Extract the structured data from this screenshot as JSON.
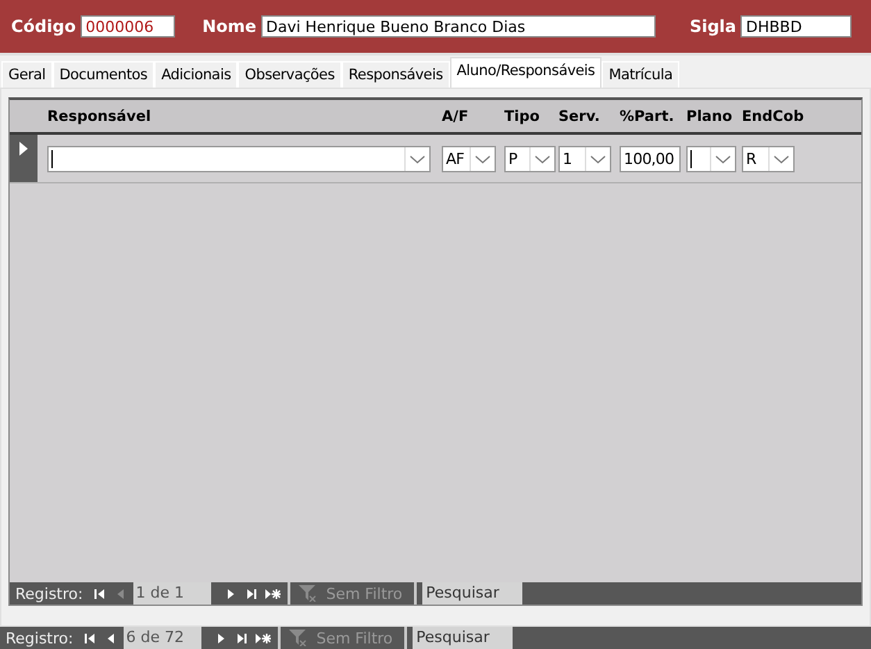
{
  "header": {
    "fields": [
      {
        "label": "Código",
        "value": "0000006",
        "kind": "code"
      },
      {
        "label": "Nome",
        "value": "Davi Henrique Bueno Branco Dias",
        "kind": "text"
      },
      {
        "label": "Sigla",
        "value": "DHBBD",
        "kind": "text"
      }
    ]
  },
  "tabs": [
    {
      "label": "Geral",
      "selected": false
    },
    {
      "label": "Documentos",
      "selected": false
    },
    {
      "label": "Adicionais",
      "selected": false
    },
    {
      "label": "Observações",
      "selected": false
    },
    {
      "label": "Responsáveis",
      "selected": false
    },
    {
      "label": "Aluno/Responsáveis",
      "selected": true
    },
    {
      "label": "Matrícula",
      "selected": false
    }
  ],
  "subform": {
    "columns": [
      {
        "header": "Responsável",
        "kind": "combo"
      },
      {
        "header": "A/F",
        "value": "AF",
        "kind": "combo"
      },
      {
        "header": "Tipo",
        "value": "P",
        "kind": "combo"
      },
      {
        "header": "Serv.",
        "value": "1",
        "kind": "combo"
      },
      {
        "header": "%Part.",
        "value": "100,00",
        "kind": "text"
      },
      {
        "header": "Plano",
        "kind": "combo"
      },
      {
        "header": "EndCob",
        "value": "R",
        "kind": "combo"
      }
    ],
    "nav": {
      "label": "Registro:",
      "position": "1 de 1",
      "prev_disabled": true,
      "filter": "Sem Filtro",
      "search": "Pesquisar"
    }
  },
  "nav": {
    "label": "Registro:",
    "position": "6 de 72",
    "prev_disabled": false,
    "filter": "Sem Filtro",
    "search": "Pesquisar"
  }
}
